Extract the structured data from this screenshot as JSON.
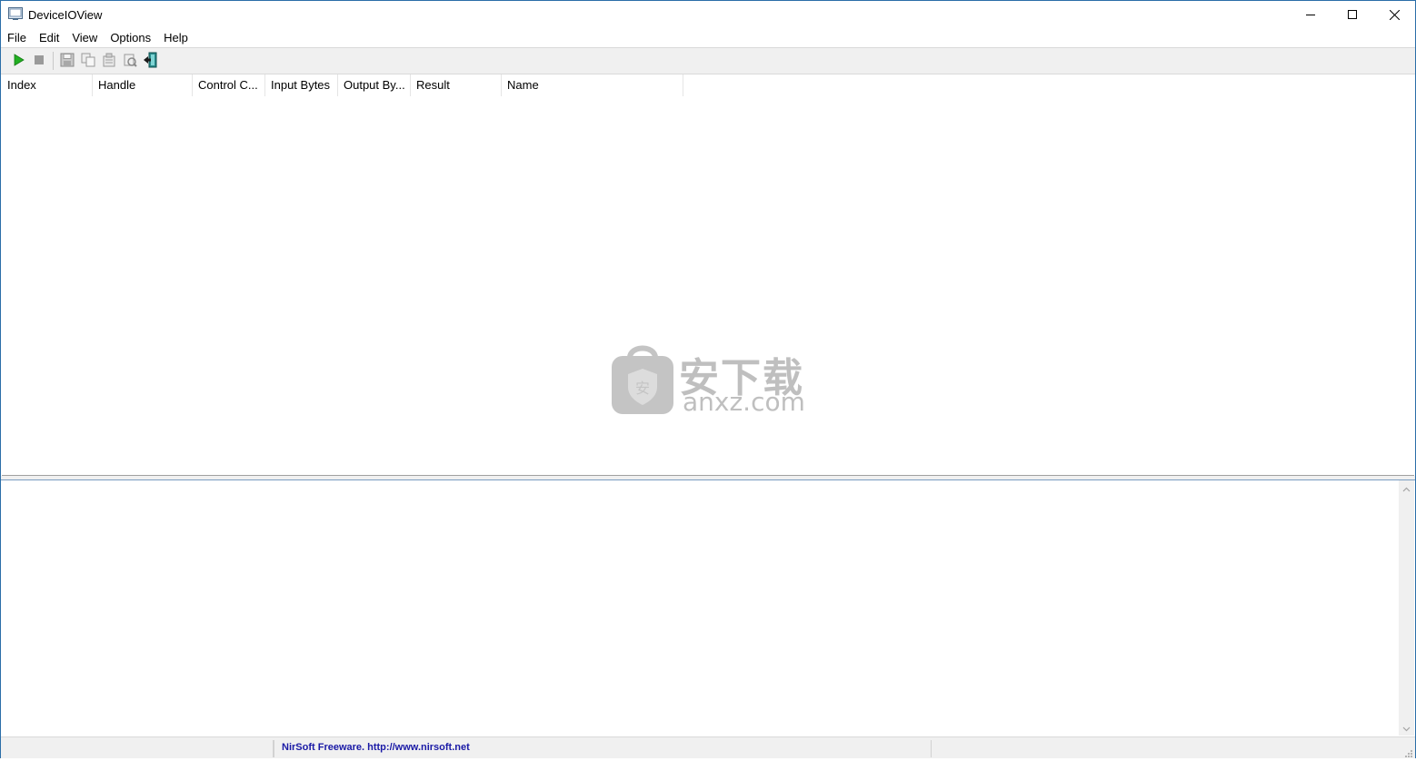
{
  "window": {
    "title": "DeviceIOView"
  },
  "icons": {
    "app": "app-icon",
    "minimize": "minimize-icon",
    "maximize": "maximize-icon",
    "close": "close-icon",
    "toolbar": [
      "play-icon",
      "stop-icon",
      "save-icon",
      "copy-icon",
      "properties-icon",
      "options-icon",
      "exit-icon"
    ]
  },
  "menu": {
    "items": [
      "File",
      "Edit",
      "View",
      "Options",
      "Help"
    ]
  },
  "list": {
    "columns": [
      "Index",
      "Handle",
      "Control C...",
      "Input Bytes",
      "Output By...",
      "Result",
      "Name"
    ]
  },
  "status": {
    "link_text": "NirSoft Freeware.  http://www.nirsoft.net"
  },
  "watermark": {
    "line1": "安下载",
    "line2": "anxz.com"
  },
  "colors": {
    "link": "#1a1aa6",
    "accent_play": "#22b022",
    "frame": "#2b6ea8"
  }
}
